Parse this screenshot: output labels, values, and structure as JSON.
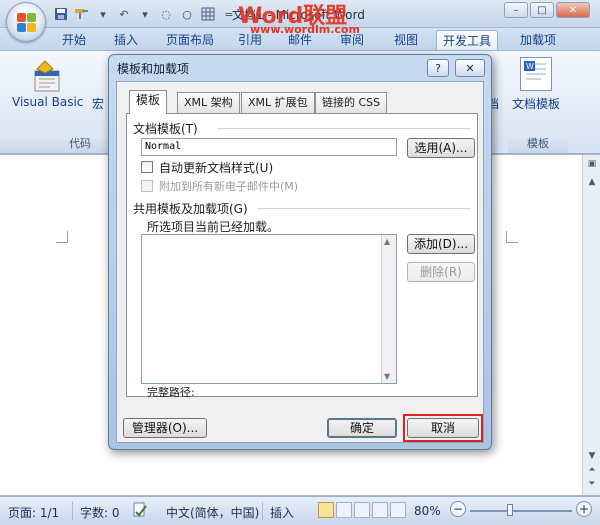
{
  "window": {
    "doc_title": "文档1 - Microsoft Word",
    "watermark_brand": "Word联盟",
    "watermark_url": "www.wordlm.com",
    "controls": {
      "minimize": "–",
      "maximize": "□",
      "close": "✕"
    }
  },
  "quick_access": [
    "save-icon",
    "format-painter-icon",
    "undo-icon",
    "redo-icon",
    "stop-icon",
    "grid-icon",
    "customize-icon"
  ],
  "ribbon_tabs": [
    {
      "label": "开始"
    },
    {
      "label": "插入"
    },
    {
      "label": "页面布局"
    },
    {
      "label": "引用"
    },
    {
      "label": "邮件"
    },
    {
      "label": "审阅"
    },
    {
      "label": "视图"
    },
    {
      "label": "开发工具",
      "active": true
    },
    {
      "label": "加载项"
    }
  ],
  "ribbon": {
    "visual_basic": "Visual Basic",
    "macro": "宏",
    "code_group": "代码",
    "hidden_tail": "档",
    "document_template": "文档模板",
    "template_group": "模板"
  },
  "dialog": {
    "title": "模板和加载项",
    "help": "?",
    "close": "✕",
    "tabs": [
      {
        "label": "模板",
        "active": true
      },
      {
        "label": "XML 架构"
      },
      {
        "label": "XML 扩展包"
      },
      {
        "label": "链接的 CSS"
      }
    ],
    "doc_template_label": "文档模板(T)",
    "template_value": "Normal",
    "select_button": "选用(A)...",
    "auto_update_label": "自动更新文档样式(U)",
    "auto_update_checked": false,
    "attach_mail_label": "附加到所有新电子邮件中(M)",
    "attach_mail_checked": false,
    "shared_label": "共用模板及加载项(G)",
    "shared_hint": "所选项目当前已经加载。",
    "add_button": "添加(D)...",
    "remove_button": "删除(R)",
    "full_path_label": "完整路径:",
    "organizer_button": "管理器(O)...",
    "ok_button": "确定",
    "cancel_button": "取消"
  },
  "statusbar": {
    "page": "页面: 1/1",
    "words": "字数: 0",
    "language": "中文(简体，中国)",
    "insert_mode": "插入",
    "zoom": "80%",
    "zoom_value": 0.8,
    "zoom_out": "−",
    "zoom_in": "+"
  },
  "colors": {
    "accent": "#15428b",
    "highlight": "#e0201a",
    "watermark": "#e8331f"
  }
}
